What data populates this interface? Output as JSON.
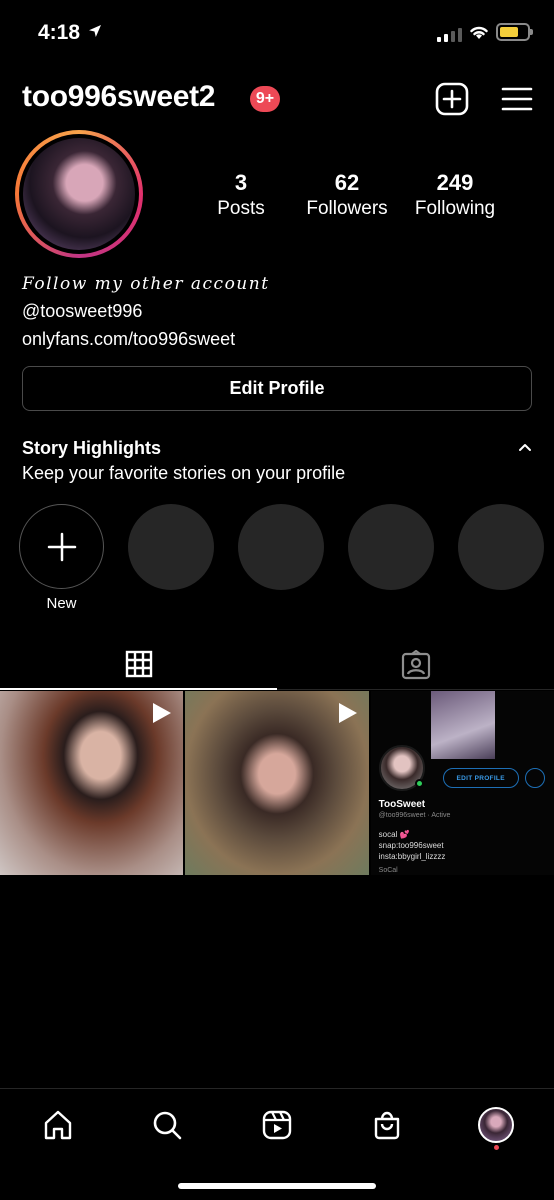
{
  "status_bar": {
    "time": "4:18"
  },
  "header": {
    "username": "too996sweet2",
    "notification_badge": "9+"
  },
  "profile": {
    "stats": [
      {
        "value": "3",
        "label": "Posts"
      },
      {
        "value": "62",
        "label": "Followers"
      },
      {
        "value": "249",
        "label": "Following"
      }
    ],
    "bio": {
      "fancy_line": "Follow my other account",
      "line1": "@toosweet996",
      "line2": "onlyfans.com/too996sweet"
    },
    "edit_profile_label": "Edit Profile"
  },
  "highlights": {
    "title": "Story Highlights",
    "subtitle": "Keep your favorite stories on your profile",
    "new_label": "New",
    "empty_count": 4
  },
  "tabs": [
    {
      "icon": "grid-icon",
      "active": true
    },
    {
      "icon": "tagged-icon",
      "active": false
    }
  ],
  "posts": [
    {
      "type": "video",
      "icon": "play-icon"
    },
    {
      "type": "video",
      "icon": "play-icon"
    },
    {
      "type": "image",
      "inner": {
        "name": "TooSweet",
        "handle": "@too996sweet",
        "handle_status": "Active",
        "edit_label": "EDIT PROFILE",
        "bio_lines": [
          "socal 💕",
          "snap:too996sweet",
          "insta:bbygirl_lizzzz"
        ],
        "location": "SoCal"
      }
    }
  ],
  "bottom_nav": [
    "home-icon",
    "search-icon",
    "reels-icon",
    "shop-icon",
    "profile-avatar"
  ],
  "colors": {
    "badge": "#ed4956",
    "background": "#000000",
    "accent_blue": "#3a9be8"
  }
}
